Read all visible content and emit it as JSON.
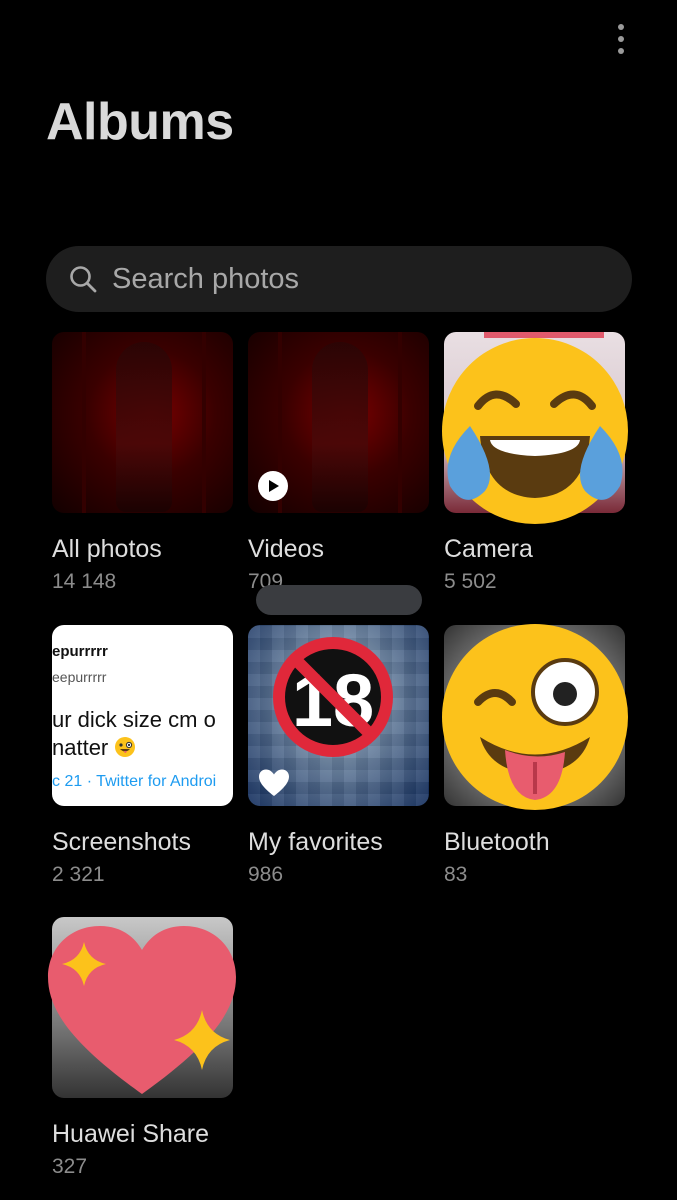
{
  "header": {
    "title": "Albums",
    "menu_icon": "more-vertical-icon"
  },
  "search": {
    "placeholder": "Search photos",
    "icon": "search-icon"
  },
  "albums": [
    {
      "name": "All photos",
      "count": "14 148"
    },
    {
      "name": "Videos",
      "count": "709"
    },
    {
      "name": "Camera",
      "count": "5 502"
    },
    {
      "name": "Screenshots",
      "count": "2 321"
    },
    {
      "name": "My favorites",
      "count": "986"
    },
    {
      "name": "Bluetooth",
      "count": "83"
    },
    {
      "name": "Huawei Share",
      "count": "327"
    }
  ],
  "screenshot_thumb": {
    "line1": "epurrrrr",
    "line2": "eepurrrrr",
    "line3": "ur dick size cm o",
    "line4": "natter",
    "line5": "c 21 · Twitter for Androi"
  },
  "favorites_badge_text": "18",
  "colors": {
    "background": "#000000",
    "search_bg": "#1e1e1e",
    "emoji_yellow": "#fcc21b",
    "heart_pink": "#e85c6e",
    "no_sign_red": "#e0283a"
  }
}
